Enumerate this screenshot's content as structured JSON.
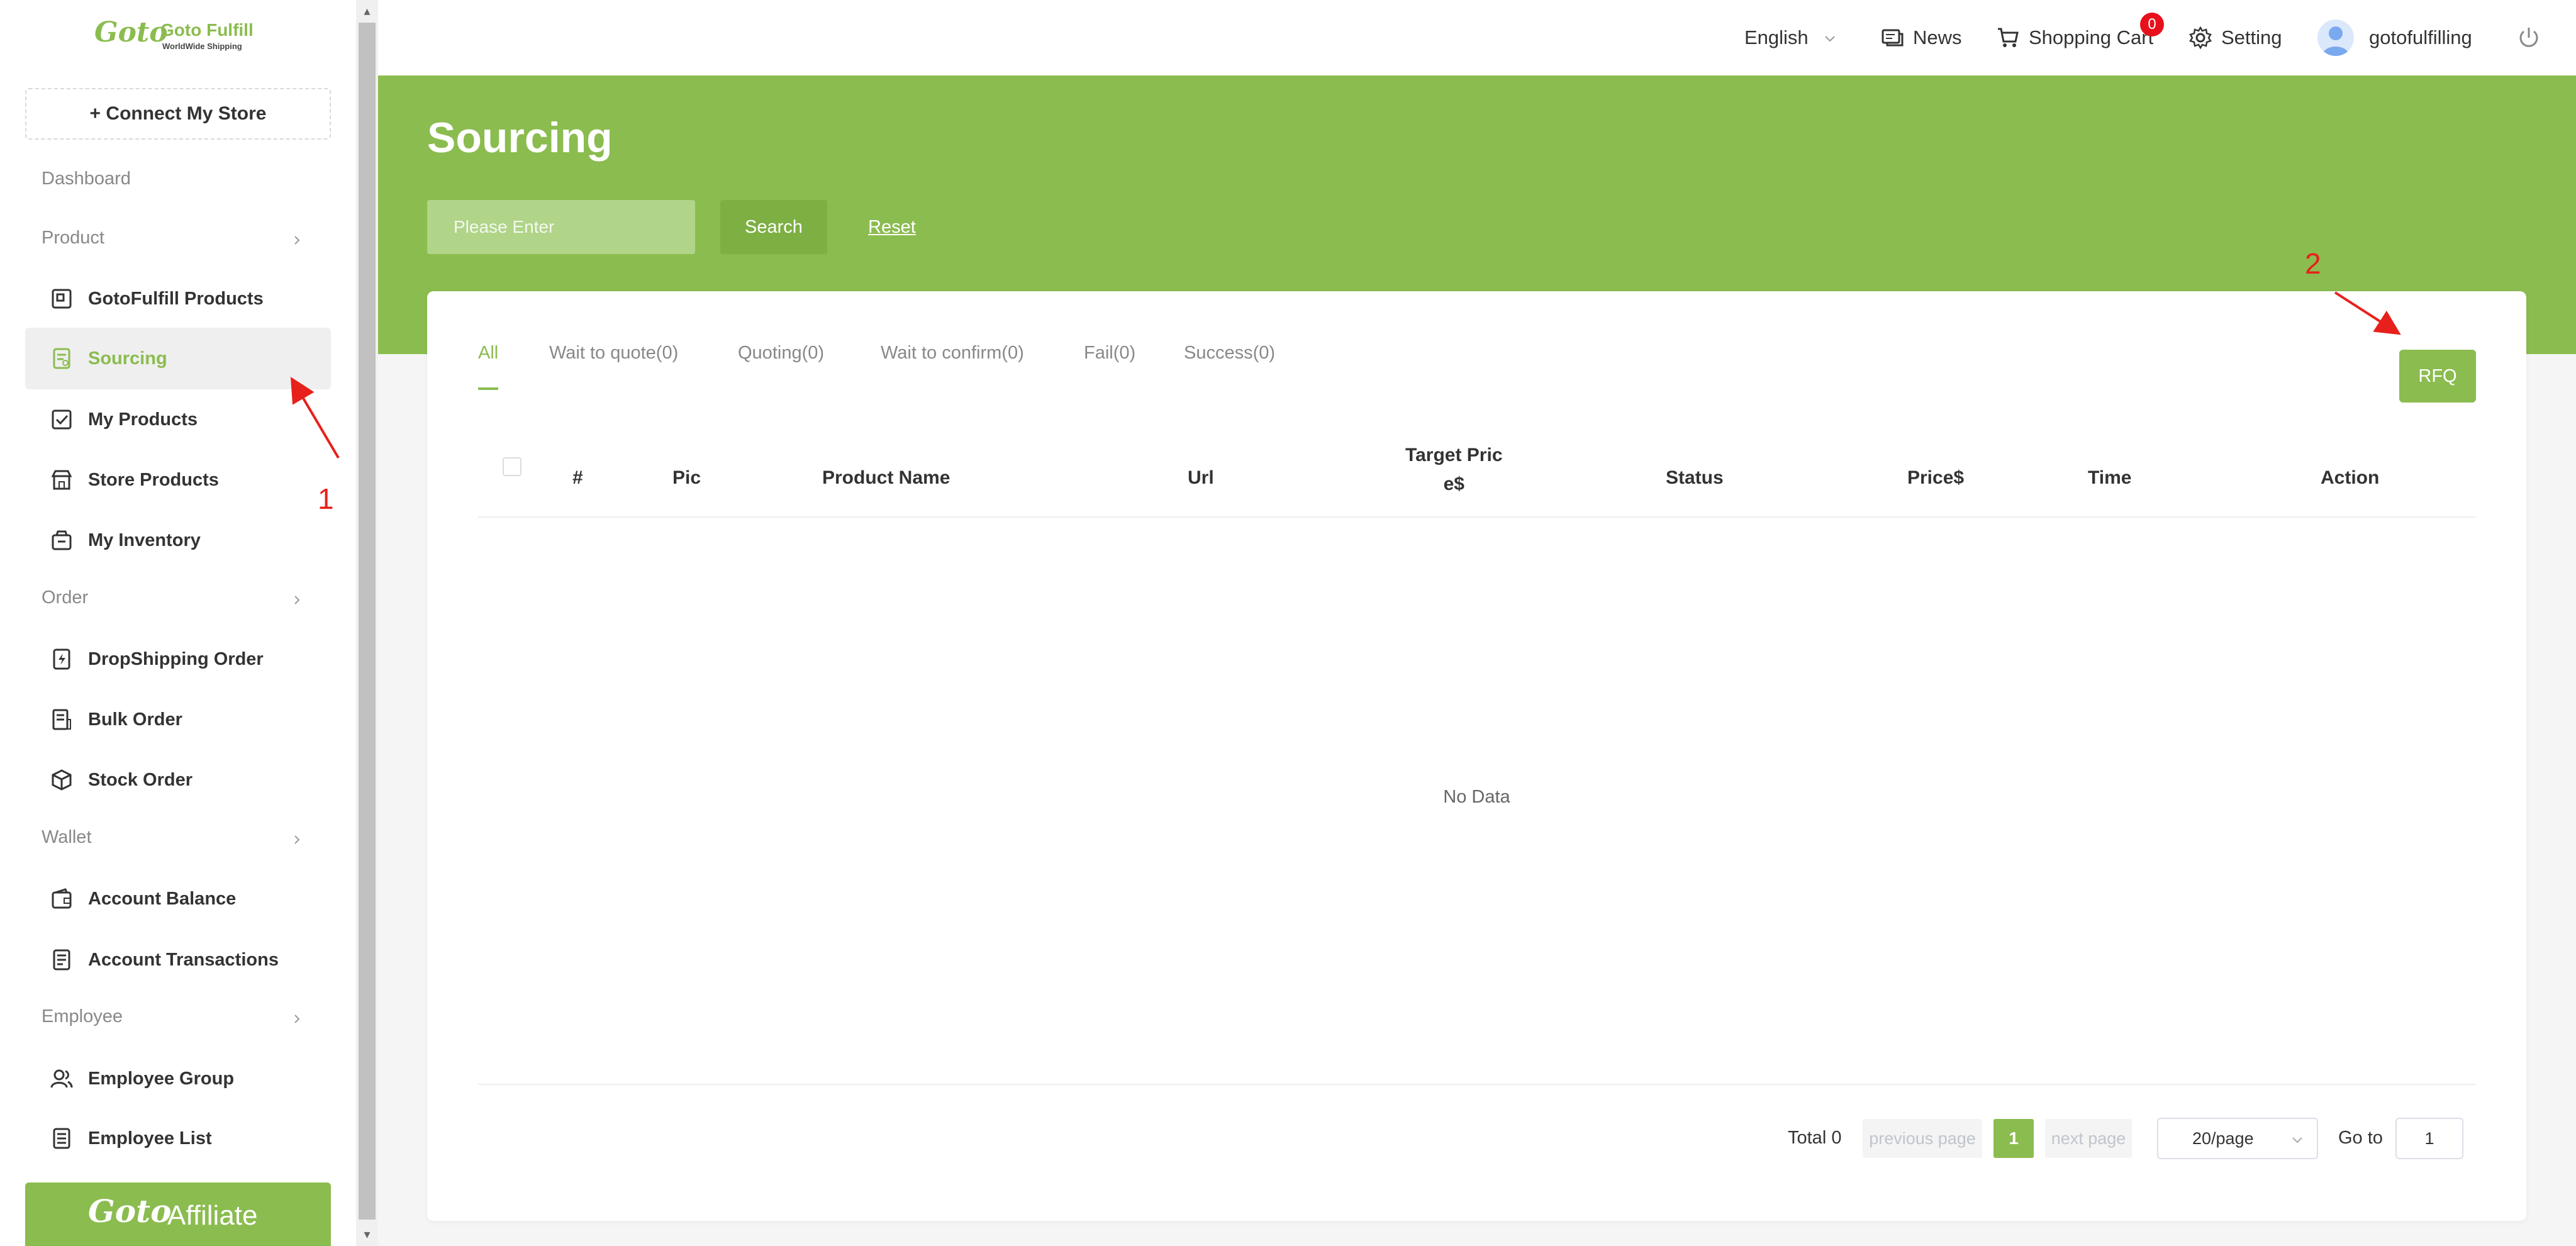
{
  "brand": {
    "logo_word": "Goto",
    "name": "Goto Fulfill",
    "tagline": "WorldWide Shipping"
  },
  "sidebar": {
    "connect_label": "+ Connect My Store",
    "dashboard": "Dashboard",
    "groups": {
      "product": "Product",
      "order": "Order",
      "wallet": "Wallet",
      "employee": "Employee"
    },
    "items": {
      "gotofulfill_products": "GotoFulfill Products",
      "sourcing": "Sourcing",
      "my_products": "My Products",
      "store_products": "Store Products",
      "my_inventory": "My Inventory",
      "dropshipping_order": "DropShipping Order",
      "bulk_order": "Bulk Order",
      "stock_order": "Stock Order",
      "account_balance": "Account Balance",
      "account_transactions": "Account Transactions",
      "employee_group": "Employee Group",
      "employee_list": "Employee List"
    },
    "affiliate_label": "Affiliate"
  },
  "topbar": {
    "language": "English",
    "news": "News",
    "cart": "Shopping Cart",
    "cart_count": "0",
    "setting": "Setting",
    "username": "gotofulfilling"
  },
  "page": {
    "title": "Sourcing",
    "search_placeholder": "Please Enter",
    "search_label": "Search",
    "reset_label": "Reset",
    "rfq_label": "RFQ"
  },
  "tabs": [
    "All",
    "Wait to quote(0)",
    "Quoting(0)",
    "Wait to confirm(0)",
    "Fail(0)",
    "Success(0)"
  ],
  "table": {
    "headers": {
      "num": "#",
      "pic": "Pic",
      "product_name": "Product Name",
      "url": "Url",
      "target_price_l1": "Target Pric",
      "target_price_l2": "e$",
      "status": "Status",
      "price": "Price$",
      "time": "Time",
      "action": "Action"
    },
    "empty_text": "No Data"
  },
  "pagination": {
    "total": "Total 0",
    "prev": "previous page",
    "current": "1",
    "next": "next page",
    "page_size": "20/page",
    "goto_label": "Go to",
    "goto_value": "1"
  },
  "annotations": {
    "marker_1": "1",
    "marker_2": "2"
  },
  "colors": {
    "accent": "#8bbc4f",
    "badge": "#e8101b",
    "annotation": "#e8201b"
  }
}
